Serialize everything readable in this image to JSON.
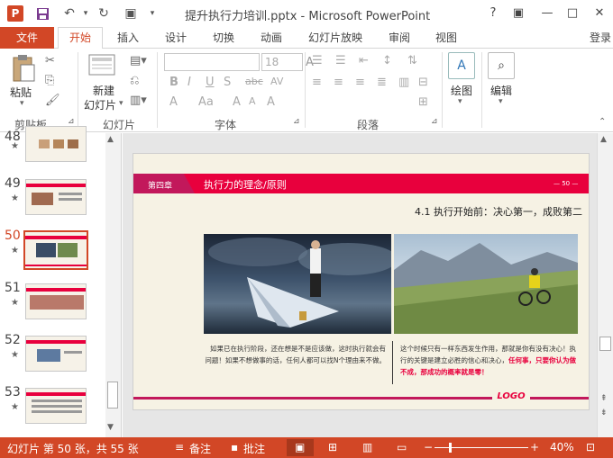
{
  "window": {
    "title": "提升执行力培训.pptx - Microsoft PowerPoint",
    "help": "?",
    "login": "登录"
  },
  "tabs": [
    "文件",
    "开始",
    "插入",
    "设计",
    "切换",
    "动画",
    "幻灯片放映",
    "审阅",
    "视图"
  ],
  "ribbon": {
    "paste": "粘贴",
    "new_slide_line1": "新建",
    "new_slide_line2": "幻灯片",
    "font_size": "18",
    "drawing": "绘图",
    "editing": "编辑",
    "groups": [
      "剪贴板",
      "幻灯片",
      "字体",
      "段落"
    ]
  },
  "thumbnails": [
    {
      "num": "48"
    },
    {
      "num": "49"
    },
    {
      "num": "50"
    },
    {
      "num": "51"
    },
    {
      "num": "52"
    },
    {
      "num": "53"
    }
  ],
  "slide": {
    "chapter": "第四章",
    "heading": "执行力的理念/原则",
    "page": "— 50 —",
    "subtitle": "4.1 执行开始前：决心第一，成败第二",
    "left_text": "如果已在执行阶段，还在想是不是应该做，这时执行就会有问题！如果不想做事的话，任何人都可以找N个理由来不做。",
    "right_text_normal": "这个时候只有一样东西发生作用，那就是你有没有决心！执行的关键是建立必胜的信心和决心，",
    "right_text_red": "任何事，只要你认为做不成，那成功的概率就是零！",
    "logo": "LOGO"
  },
  "status": {
    "slide_info": "幻灯片 第 50 张，共 55 张",
    "notes": "备注",
    "comments": "批注",
    "zoom": "40%"
  },
  "colors": {
    "accent": "#d24726",
    "slide_band": "#e8003d",
    "chapter_tag": "#c2185b"
  }
}
